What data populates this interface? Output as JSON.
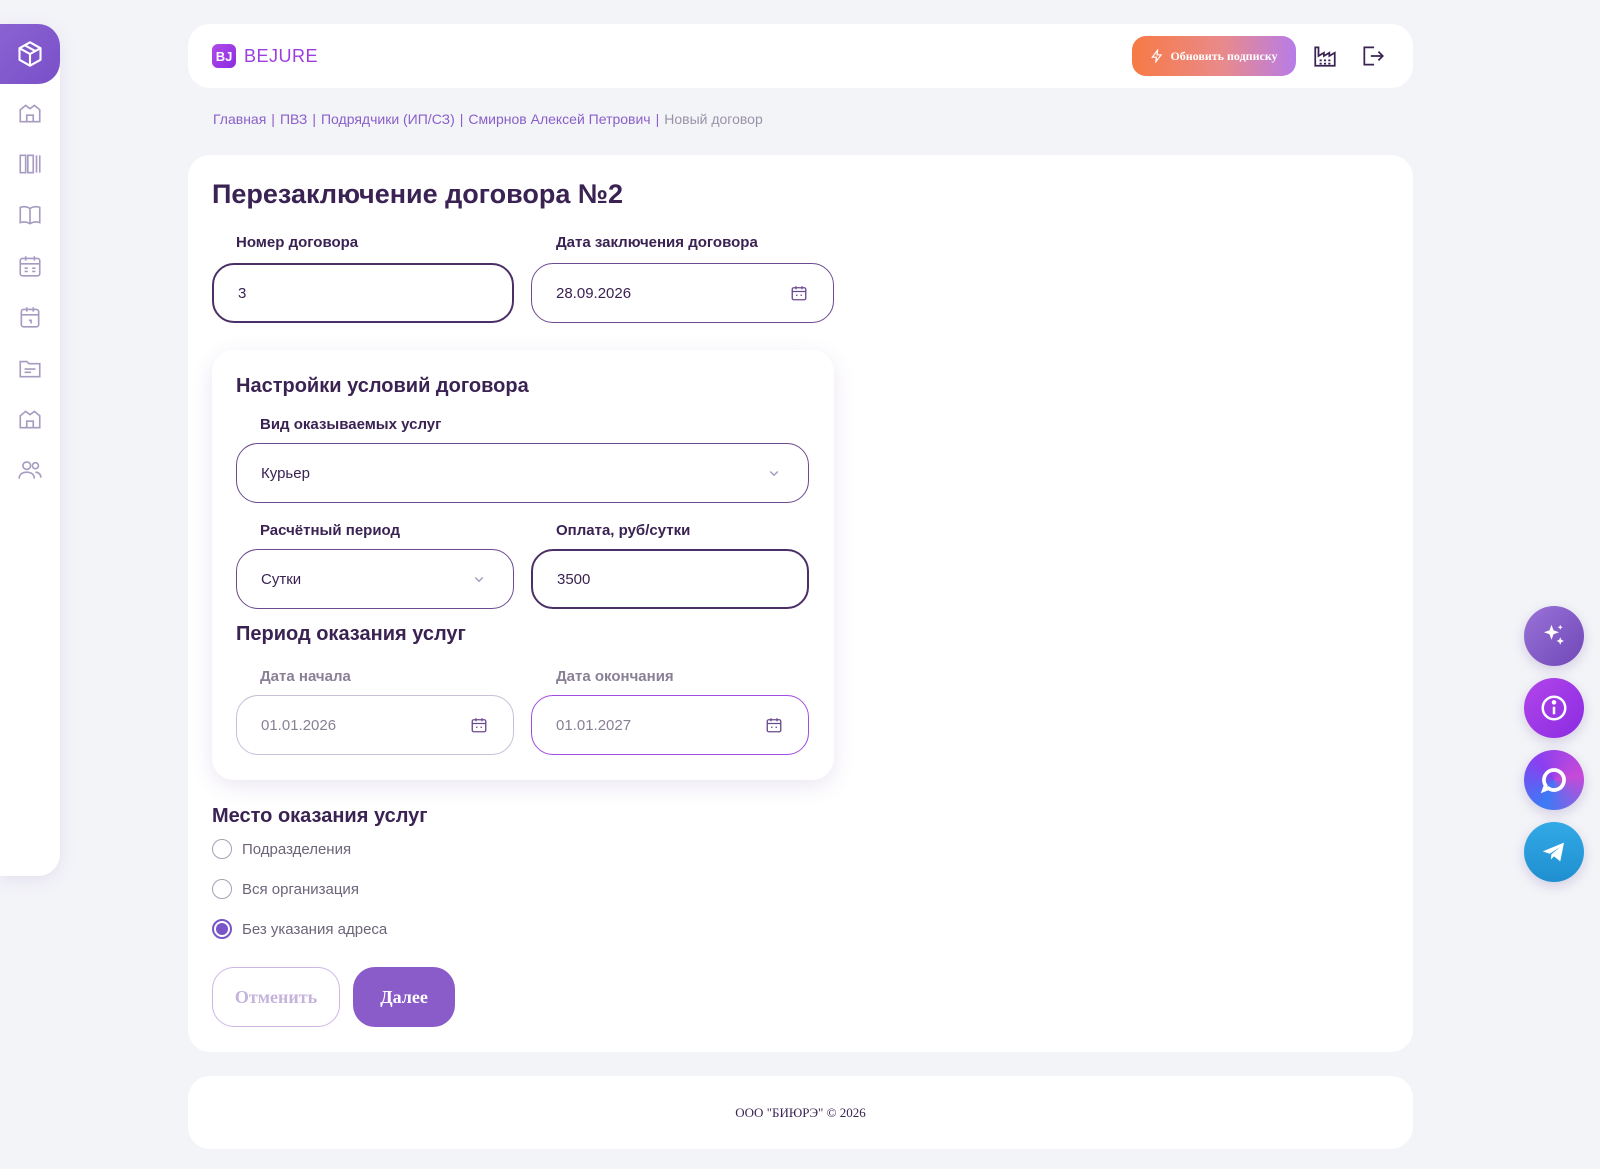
{
  "app": {
    "logo_mark": "BJ",
    "logo_text": "BEJURE"
  },
  "header": {
    "upgrade_label": "Обновить подписку",
    "icons": [
      "factory-icon",
      "logout-icon"
    ]
  },
  "sidebar": {
    "items": [
      "box-icon",
      "warehouse-icon",
      "columns-icon",
      "book-icon",
      "calendar-grid-icon",
      "calendar-icon",
      "folder-icon",
      "warehouse-icon",
      "users-icon"
    ]
  },
  "breadcrumb": {
    "items": [
      "Главная",
      "ПВЗ",
      "Подрядчики (ИП/СЗ)",
      "Смирнов Алексей Петрович"
    ],
    "current": "Новый договор"
  },
  "form": {
    "title": "Перезаключение договора №2",
    "contract_number": {
      "label": "Номер договора",
      "value": "3"
    },
    "contract_date": {
      "label": "Дата заключения договора",
      "value": "28.09.2026"
    },
    "settings": {
      "title": "Настройки условий договора",
      "service_type": {
        "label": "Вид оказываемых услуг",
        "value": "Курьер"
      },
      "billing_period": {
        "label": "Расчётный период",
        "value": "Сутки"
      },
      "payment": {
        "label": "Оплата, руб/сутки",
        "value": "3500"
      },
      "period_title": "Период оказания услуг",
      "start_date": {
        "label": "Дата начала",
        "value": "01.01.2026"
      },
      "end_date": {
        "label": "Дата окончания",
        "value": "01.01.2027"
      }
    },
    "place": {
      "title": "Место оказания услуг",
      "options": [
        "Подразделения",
        "Вся организация",
        "Без указания адреса"
      ],
      "selected": "Без указания адреса"
    },
    "cancel_label": "Отменить",
    "next_label": "Далее"
  },
  "footer": {
    "text": "ООО \"БИЮРЭ\" © 2026"
  },
  "fabs": [
    "sparkle-icon",
    "info-icon",
    "chat-icon",
    "telegram-icon"
  ],
  "colors": {
    "accent": "#8a5cc9",
    "text": "#3a2252",
    "background": "#f3f4f8"
  }
}
